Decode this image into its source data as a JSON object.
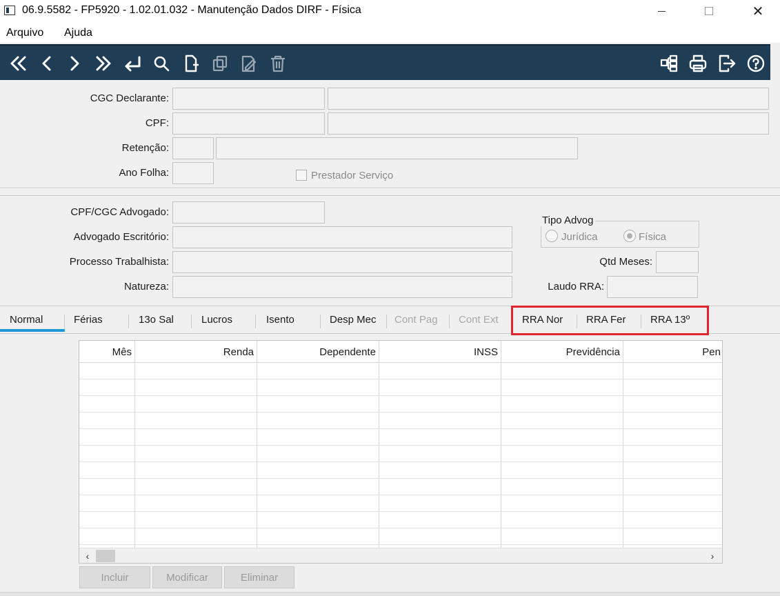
{
  "window": {
    "title": "06.9.5582 - FP5920 - 1.02.01.032 - Manutenção Dados DIRF - Física",
    "close_glyph": "✕"
  },
  "menu": {
    "items": [
      {
        "label": "Arquivo"
      },
      {
        "label": "Ajuda"
      }
    ]
  },
  "toolbar": {
    "left_icons": [
      "first-record-icon",
      "previous-record-icon",
      "next-record-icon",
      "last-record-icon",
      "return-icon",
      "search-icon",
      "new-document-icon",
      "copy-icon",
      "edit-icon",
      "delete-icon"
    ],
    "right_icons": [
      "tree-icon",
      "print-icon",
      "exit-icon",
      "help-icon"
    ],
    "background": "#1f3d55"
  },
  "form": {
    "cgc_label": "CGC Declarante:",
    "cpf_label": "CPF:",
    "retencao_label": "Retenção:",
    "ano_folha_label": "Ano Folha:",
    "prestador_label": "Prestador Serviço",
    "cpf_cgc_adv_label": "CPF/CGC Advogado:",
    "adv_escritorio_label": "Advogado Escritório:",
    "processo_label": "Processo Trabalhista:",
    "natureza_label": "Natureza:",
    "tipo_advog_label": "Tipo Advog",
    "juridica_label": "Jurídica",
    "fisica_label": "Física",
    "qtd_meses_label": "Qtd Meses:",
    "laudo_label": "Laudo RRA:"
  },
  "tabs": [
    {
      "label": "Normal",
      "state": "active"
    },
    {
      "label": "Férias",
      "state": "enabled"
    },
    {
      "label": "13o Sal",
      "state": "enabled"
    },
    {
      "label": "Lucros",
      "state": "enabled"
    },
    {
      "label": "Isento",
      "state": "enabled"
    },
    {
      "label": "Desp Mec",
      "state": "enabled"
    },
    {
      "label": "Cont Pag",
      "state": "disabled"
    },
    {
      "label": "Cont Ext",
      "state": "disabled"
    },
    {
      "label": "RRA Nor",
      "state": "enabled"
    },
    {
      "label": "RRA Fer",
      "state": "enabled"
    },
    {
      "label": "RRA 13º",
      "state": "enabled"
    }
  ],
  "grid": {
    "columns": [
      "Mês",
      "Renda",
      "Dependente",
      "INSS",
      "Previdência",
      "Pen"
    ],
    "scroll_left": "‹",
    "scroll_right": "›"
  },
  "buttons": {
    "incluir": "Incluir",
    "modificar": "Modificar",
    "eliminar": "Eliminar"
  },
  "colors": {
    "accent_tab": "#1e9ad6",
    "highlight": "#e02530"
  }
}
